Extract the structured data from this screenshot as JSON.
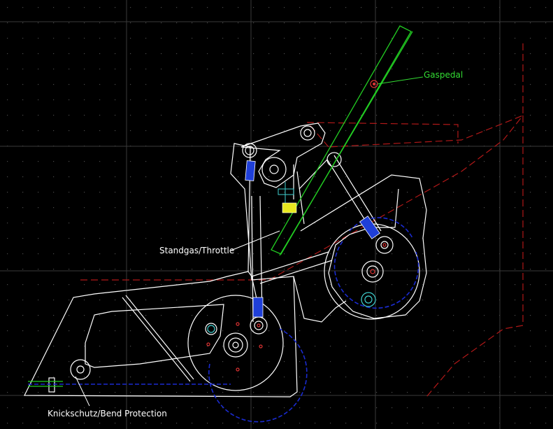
{
  "labels": {
    "gaspedal": "Gaspedal",
    "standgas": "Standgas/Throttle",
    "knickschutz": "Knickschutz/Bend Protection"
  },
  "colors": {
    "background": "#000000",
    "grid_dot": "#4a4a4a",
    "grid_line": "#3a3a3a",
    "outline": "#ffffff",
    "pedal": "#22cc22",
    "dashed_red": "#b01818",
    "dashed_blue": "#1a2bd0",
    "cylinder": "#1f3fd8",
    "label_green": "#33dd33",
    "label_white": "#ffffff",
    "yellow_part": "#e8e820",
    "cyan_part": "#40d0d0"
  },
  "icons": [
    "pivot-icon",
    "spring-icon"
  ]
}
